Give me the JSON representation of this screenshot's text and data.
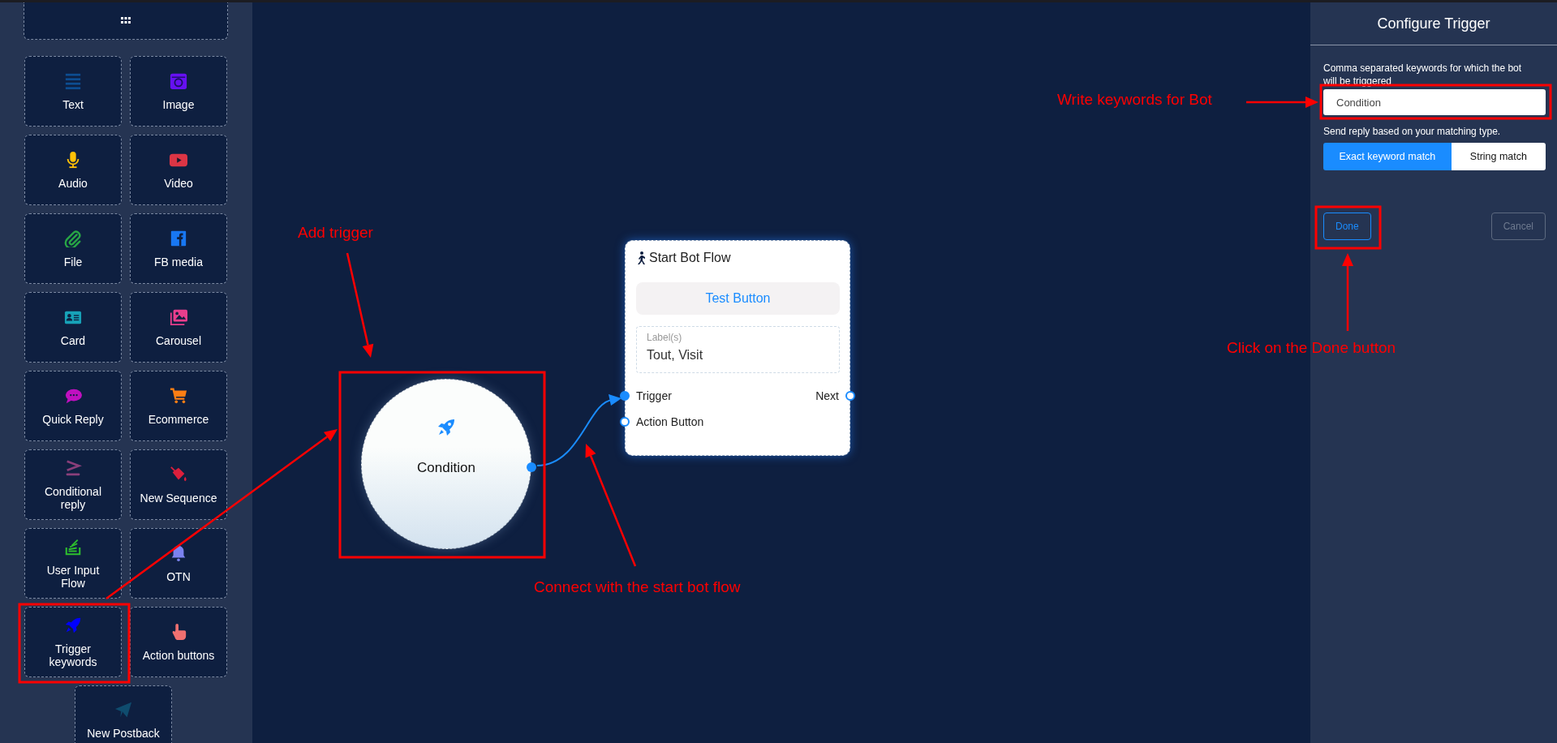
{
  "sidebar": {
    "tiles": [
      {
        "label": "Text"
      },
      {
        "label": "Image"
      },
      {
        "label": "Audio"
      },
      {
        "label": "Video"
      },
      {
        "label": "File"
      },
      {
        "label": "FB media"
      },
      {
        "label": "Card"
      },
      {
        "label": "Carousel"
      },
      {
        "label": "Quick Reply"
      },
      {
        "label": "Ecommerce"
      },
      {
        "label": "Conditional\nreply"
      },
      {
        "label": "New Sequence"
      },
      {
        "label": "User Input\nFlow"
      },
      {
        "label": "OTN"
      },
      {
        "label": "Trigger\nkeywords"
      },
      {
        "label": "Action buttons"
      },
      {
        "label": "New Postback"
      }
    ]
  },
  "canvas": {
    "condition_node": {
      "label": "Condition"
    },
    "flow_card": {
      "title": "Start Bot Flow",
      "test_button": "Test Button",
      "labels_caption": "Label(s)",
      "labels_value": "Tout, Visit",
      "ports": [
        {
          "label": "Trigger",
          "connected": true
        },
        {
          "label": "Next",
          "connected": false
        },
        {
          "label": "Action Button",
          "connected": false
        }
      ]
    }
  },
  "panel": {
    "title": "Configure Trigger",
    "keywords_label": "Comma separated keywords for which the bot will be triggered",
    "keywords_value": "Condition",
    "match_label": "Send reply based on your matching type.",
    "match_options": [
      {
        "label": "Exact keyword match",
        "selected": true
      },
      {
        "label": "String match",
        "selected": false
      }
    ],
    "buttons": [
      {
        "label": "Done",
        "kind": "primary"
      },
      {
        "label": "Cancel",
        "kind": "secondary"
      }
    ]
  },
  "annotations": [
    {
      "text": "Add trigger"
    },
    {
      "text": "Connect with the start bot flow"
    },
    {
      "text": "Write keywords for Bot"
    },
    {
      "text": "Click on the Done button"
    }
  ]
}
